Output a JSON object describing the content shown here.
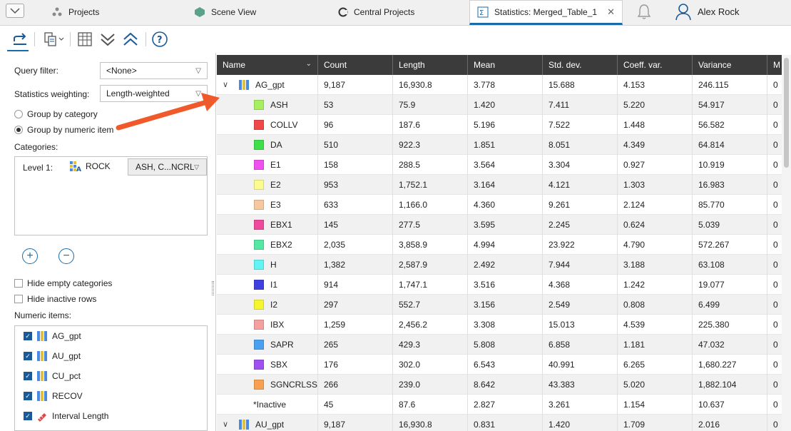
{
  "tabs": [
    {
      "label": "Projects",
      "icon": "projects-icon"
    },
    {
      "label": "Scene View",
      "icon": "scene-view-icon"
    },
    {
      "label": "Central Projects",
      "icon": "central-projects-icon"
    },
    {
      "label": "Statistics: Merged_Table_1",
      "icon": "statistics-icon",
      "active": true
    }
  ],
  "user": {
    "name": "Alex Rock"
  },
  "left_panel": {
    "query_filter_label": "Query filter:",
    "query_filter_value": "<None>",
    "weighting_label": "Statistics weighting:",
    "weighting_value": "Length-weighted",
    "group_by_category": "Group by category",
    "group_by_numeric": "Group by numeric item",
    "categories_label": "Categories:",
    "level_label": "Level 1:",
    "level_column": "ROCK",
    "level_values": "ASH, C...NCRLSS...",
    "hide_empty": "Hide empty categories",
    "hide_inactive": "Hide inactive rows",
    "numeric_items_label": "Numeric items:",
    "numeric_items": [
      {
        "label": "AG_gpt",
        "checked": true
      },
      {
        "label": "AU_gpt",
        "checked": true
      },
      {
        "label": "CU_pct",
        "checked": true
      },
      {
        "label": "RECOV",
        "checked": true
      },
      {
        "label": "Interval Length",
        "checked": true
      }
    ]
  },
  "table": {
    "columns": [
      "Name",
      "Count",
      "Length",
      "Mean",
      "Std. dev.",
      "Coeff. var.",
      "Variance",
      "M"
    ],
    "group_rows": [
      {
        "name": "AG_gpt",
        "count": "9,187",
        "length": "16,930.8",
        "mean": "3.778",
        "std": "15.688",
        "cv": "4.153",
        "var": "246.115",
        "m": "0"
      }
    ],
    "rows": [
      {
        "name": "ASH",
        "color": "#a6f060",
        "count": "53",
        "length": "75.9",
        "mean": "1.420",
        "std": "7.411",
        "cv": "5.220",
        "var": "54.917",
        "m": "0"
      },
      {
        "name": "COLLV",
        "color": "#f04848",
        "count": "96",
        "length": "187.6",
        "mean": "5.196",
        "std": "7.522",
        "cv": "1.448",
        "var": "56.582",
        "m": "0"
      },
      {
        "name": "DA",
        "color": "#3ee04a",
        "count": "510",
        "length": "922.3",
        "mean": "1.851",
        "std": "8.051",
        "cv": "4.349",
        "var": "64.814",
        "m": "0"
      },
      {
        "name": "E1",
        "color": "#f050ee",
        "count": "158",
        "length": "288.5",
        "mean": "3.564",
        "std": "3.304",
        "cv": "0.927",
        "var": "10.919",
        "m": "0"
      },
      {
        "name": "E2",
        "color": "#fbfb90",
        "count": "953",
        "length": "1,752.1",
        "mean": "3.164",
        "std": "4.121",
        "cv": "1.303",
        "var": "16.983",
        "m": "0"
      },
      {
        "name": "E3",
        "color": "#f7c8a0",
        "count": "633",
        "length": "1,166.0",
        "mean": "4.360",
        "std": "9.261",
        "cv": "2.124",
        "var": "85.770",
        "m": "0"
      },
      {
        "name": "EBX1",
        "color": "#f0489a",
        "count": "145",
        "length": "277.5",
        "mean": "3.595",
        "std": "2.245",
        "cv": "0.624",
        "var": "5.039",
        "m": "0"
      },
      {
        "name": "EBX2",
        "color": "#54e8a4",
        "count": "2,035",
        "length": "3,858.9",
        "mean": "4.994",
        "std": "23.922",
        "cv": "4.790",
        "var": "572.267",
        "m": "0"
      },
      {
        "name": "H",
        "color": "#60f4f4",
        "count": "1,382",
        "length": "2,587.9",
        "mean": "2.492",
        "std": "7.944",
        "cv": "3.188",
        "var": "63.108",
        "m": "0"
      },
      {
        "name": "I1",
        "color": "#4040e0",
        "count": "914",
        "length": "1,747.1",
        "mean": "3.516",
        "std": "4.368",
        "cv": "1.242",
        "var": "19.077",
        "m": "0"
      },
      {
        "name": "I2",
        "color": "#f6f630",
        "count": "297",
        "length": "552.7",
        "mean": "3.156",
        "std": "2.549",
        "cv": "0.808",
        "var": "6.499",
        "m": "0"
      },
      {
        "name": "IBX",
        "color": "#f4a0a0",
        "count": "1,259",
        "length": "2,456.2",
        "mean": "3.308",
        "std": "15.013",
        "cv": "4.539",
        "var": "225.380",
        "m": "0"
      },
      {
        "name": "SAPR",
        "color": "#4aa0f0",
        "count": "265",
        "length": "429.3",
        "mean": "5.808",
        "std": "6.858",
        "cv": "1.181",
        "var": "47.032",
        "m": "0"
      },
      {
        "name": "SBX",
        "color": "#a050f0",
        "count": "176",
        "length": "302.0",
        "mean": "6.543",
        "std": "40.991",
        "cv": "6.265",
        "var": "1,680.227",
        "m": "0"
      },
      {
        "name": "SGNCRLSS",
        "color": "#f8a050",
        "count": "266",
        "length": "239.0",
        "mean": "8.642",
        "std": "43.383",
        "cv": "5.020",
        "var": "1,882.104",
        "m": "0"
      }
    ],
    "inactive_row": {
      "name": "*Inactive",
      "count": "45",
      "length": "87.6",
      "mean": "2.827",
      "std": "3.261",
      "cv": "1.154",
      "var": "10.637",
      "m": "0"
    },
    "group_row_2": {
      "name": "AU_gpt",
      "count": "9,187",
      "length": "16,930.8",
      "mean": "0.831",
      "std": "1.420",
      "cv": "1.709",
      "var": "2.016",
      "m": "0"
    }
  },
  "colors": {
    "accent": "#1a6ba8",
    "header_bg": "#3b3b3b",
    "annotation_arrow": "#f05a2a"
  }
}
